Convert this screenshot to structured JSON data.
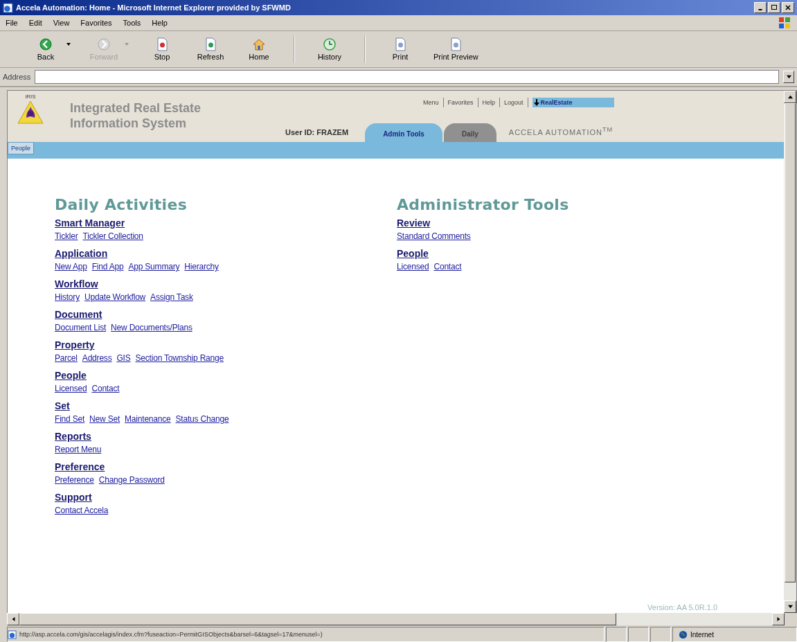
{
  "window": {
    "title": "Accela Automation: Home - Microsoft Internet Explorer provided by SFWMD"
  },
  "menu": [
    "File",
    "Edit",
    "View",
    "Favorites",
    "Tools",
    "Help"
  ],
  "toolbar": [
    [
      {
        "label": "Back",
        "kind": "back",
        "disabled": false,
        "dropdown": true
      },
      {
        "label": "Forward",
        "kind": "forward",
        "disabled": true,
        "dropdown": true
      },
      {
        "label": "Stop",
        "kind": "stop",
        "disabled": false,
        "dropdown": false
      },
      {
        "label": "Refresh",
        "kind": "refresh",
        "disabled": false,
        "dropdown": false
      },
      {
        "label": "Home",
        "kind": "home",
        "disabled": false,
        "dropdown": false
      }
    ],
    [
      {
        "label": "History",
        "kind": "history",
        "disabled": false,
        "dropdown": false
      }
    ],
    [
      {
        "label": "Print",
        "kind": "print",
        "disabled": false,
        "dropdown": false
      },
      {
        "label": "Print Preview",
        "kind": "preview",
        "disabled": false,
        "dropdown": false
      }
    ]
  ],
  "address": {
    "label": "Address"
  },
  "header": {
    "logo_caption": "iRIS",
    "app_name": [
      "Integrated Real Estate",
      "Information System"
    ],
    "top_links": [
      {
        "label": "Menu",
        "selected": false
      },
      {
        "label": "Favorites",
        "selected": false
      },
      {
        "label": "Help",
        "selected": false
      },
      {
        "label": "Logout",
        "selected": false
      },
      {
        "label": "RealEstate",
        "selected": true
      }
    ],
    "user_id": "User ID: FRAZEM",
    "tabs": [
      {
        "label": "Admin Tools",
        "selected": true
      },
      {
        "label": "Daily",
        "selected": false
      }
    ],
    "brand": "ACCELA AUTOMATION$^{TM}$"
  },
  "subnav": [
    {
      "label": "People",
      "selected": true
    }
  ],
  "columns": [
    {
      "heading": "Daily Activities",
      "sections": [
        {
          "title": "Smart Manager",
          "links": [
            "Tickler",
            "Tickler Collection"
          ]
        },
        {
          "title": "Application",
          "links": [
            "New App",
            "Find App",
            "App Summary",
            "Hierarchy"
          ]
        },
        {
          "title": "Workflow",
          "links": [
            "History",
            "Update Workflow",
            "Assign Task"
          ]
        },
        {
          "title": "Document",
          "links": [
            "Document List",
            "New Documents/Plans"
          ]
        },
        {
          "title": "Property",
          "links": [
            "Parcel",
            "Address",
            "GIS",
            "Section Township Range"
          ]
        },
        {
          "title": "People",
          "links": [
            "Licensed",
            "Contact"
          ]
        },
        {
          "title": "Set",
          "links": [
            "Find Set",
            "New Set",
            "Maintenance",
            "Status Change"
          ]
        },
        {
          "title": "Reports",
          "links": [
            "Report Menu"
          ]
        },
        {
          "title": "Preference",
          "links": [
            "Preference",
            "Change Password"
          ]
        },
        {
          "title": "Support",
          "links": [
            "Contact Accela"
          ]
        }
      ]
    },
    {
      "heading": "Administrator Tools",
      "sections": [
        {
          "title": "Review",
          "links": [
            "Standard Comments"
          ]
        },
        {
          "title": "People",
          "links": [
            "Licensed",
            "Contact"
          ]
        }
      ]
    }
  ],
  "version": "Version: AA 5.0R.1.0",
  "status_bar": {
    "url": "http://asp.accela.com/gis/accelagis/index.cfm?fuseaction=PermitGISObjects&barsel=6&tagsel=17&menusel=)",
    "zone": "Internet"
  }
}
